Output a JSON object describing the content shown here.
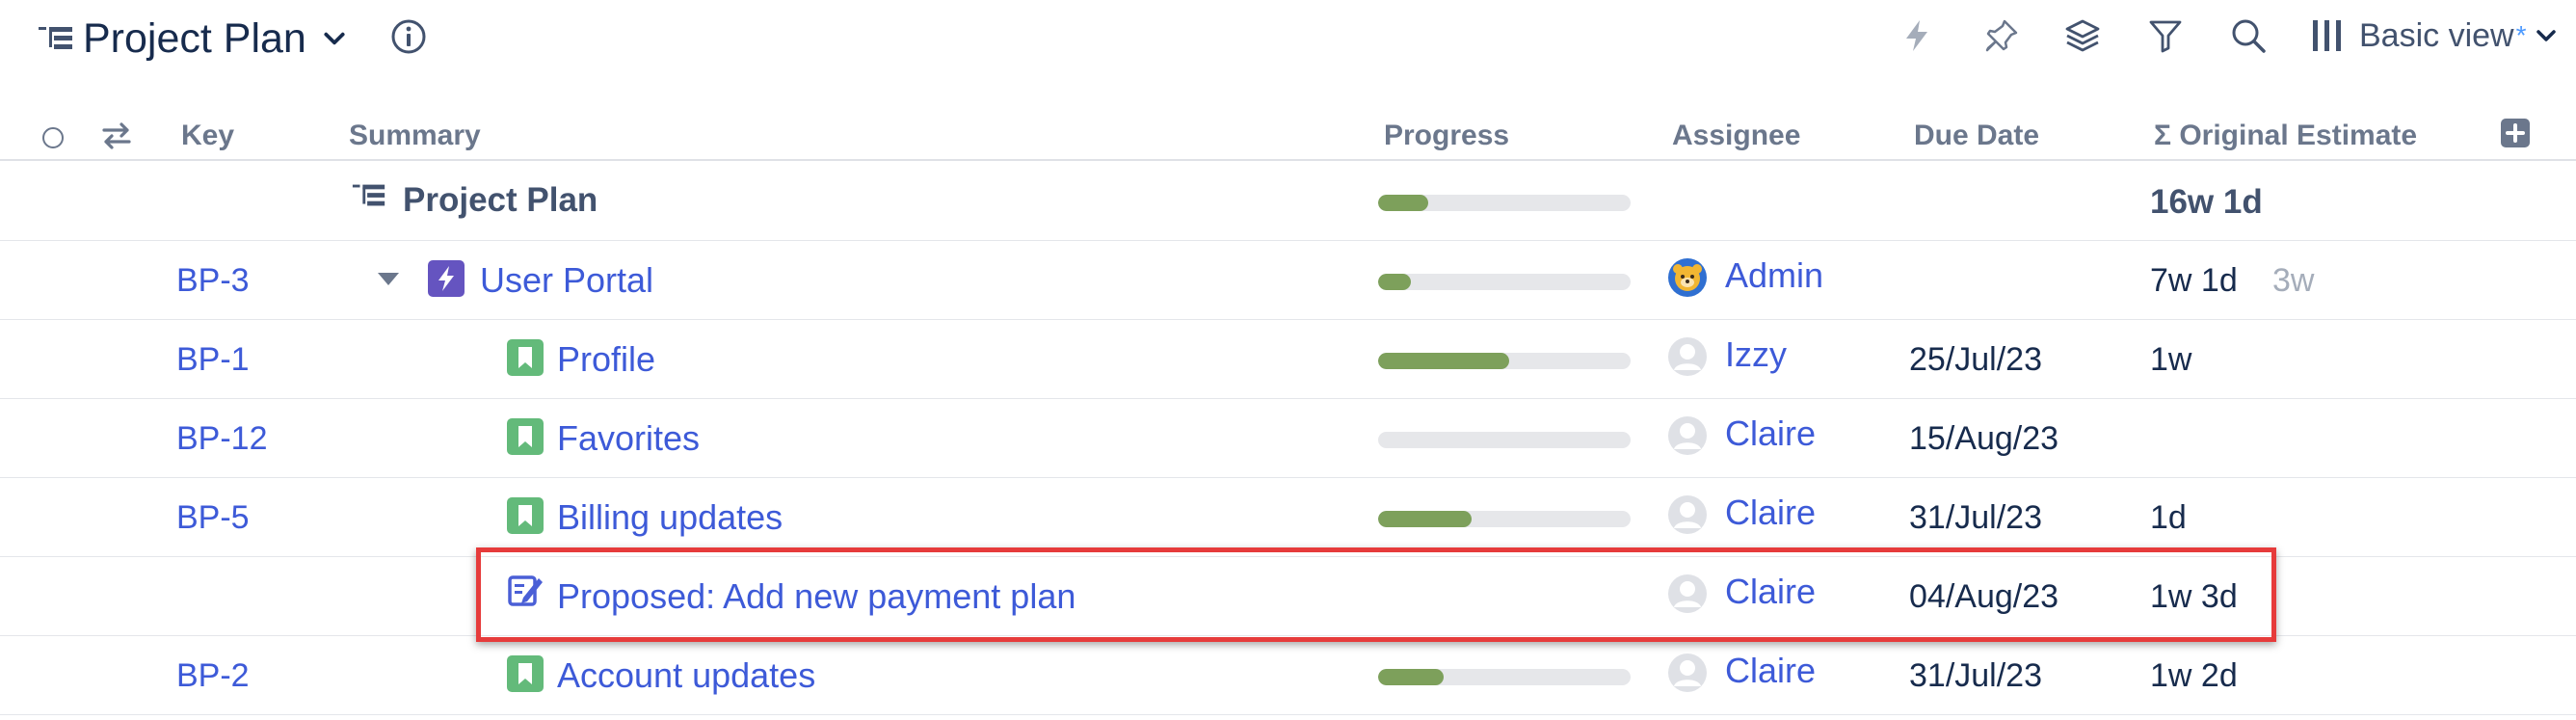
{
  "header": {
    "title": "Project Plan",
    "view_label": "Basic view",
    "view_modified_mark": "*"
  },
  "columns": {
    "key": "Key",
    "summary": "Summary",
    "progress": "Progress",
    "assignee": "Assignee",
    "due_date": "Due Date",
    "original_estimate": "Σ Original Estimate"
  },
  "rows": [
    {
      "key": "",
      "summary": "Project Plan",
      "type_icon": "structure-icon",
      "progress": 0.2,
      "assignee": "",
      "avatar": "",
      "due_date": "",
      "estimate": "16w 1d",
      "estimate_extra": ""
    },
    {
      "key": "BP-3",
      "summary": "User Portal",
      "type_icon": "epic-icon",
      "progress": 0.13,
      "assignee": "Admin",
      "avatar": "admin-avatar",
      "due_date": "",
      "estimate": "7w 1d",
      "estimate_extra": "3w"
    },
    {
      "key": "BP-1",
      "summary": "Profile",
      "type_icon": "story-icon",
      "progress": 0.52,
      "assignee": "Izzy",
      "avatar": "user-avatar",
      "due_date": "25/Jul/23",
      "estimate": "1w",
      "estimate_extra": ""
    },
    {
      "key": "BP-12",
      "summary": "Favorites",
      "type_icon": "story-icon",
      "progress": 0.0,
      "assignee": "Claire",
      "avatar": "user-avatar",
      "due_date": "15/Aug/23",
      "estimate": "",
      "estimate_extra": ""
    },
    {
      "key": "BP-5",
      "summary": "Billing updates",
      "type_icon": "story-icon",
      "progress": 0.37,
      "assignee": "Claire",
      "avatar": "user-avatar",
      "due_date": "31/Jul/23",
      "estimate": "1d",
      "estimate_extra": ""
    },
    {
      "key": "",
      "summary": "Proposed: Add new payment plan",
      "type_icon": "proposed-edit-icon",
      "progress": null,
      "assignee": "Claire",
      "avatar": "user-avatar",
      "due_date": "04/Aug/23",
      "estimate": "1w 3d",
      "estimate_extra": ""
    },
    {
      "key": "BP-2",
      "summary": "Account updates",
      "type_icon": "story-icon",
      "progress": 0.26,
      "assignee": "Claire",
      "avatar": "user-avatar",
      "due_date": "31/Jul/23",
      "estimate": "1w 2d",
      "estimate_extra": ""
    }
  ],
  "colors": {
    "link": "#3d5ad8",
    "progress_fill": "#7da05b",
    "progress_track": "#e6e7ea",
    "story_icon": "#63ba7a",
    "epic_icon": "#6554c0",
    "highlight": "#e63b3b"
  }
}
